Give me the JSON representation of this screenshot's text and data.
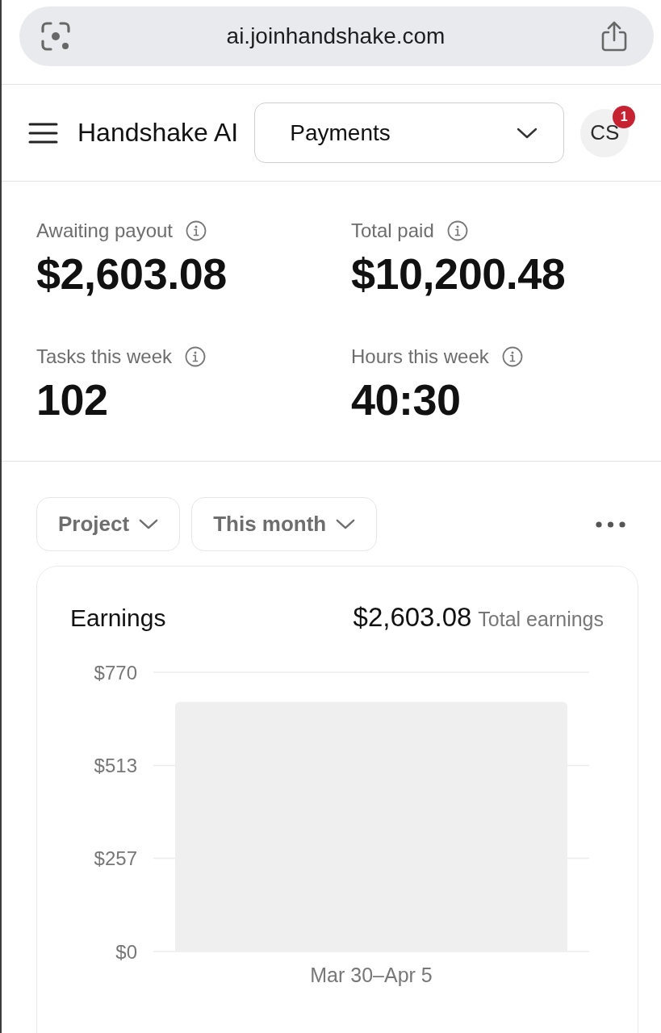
{
  "browser_bar": {
    "url": "ai.joinhandshake.com"
  },
  "header": {
    "app_name": "Handshake AI",
    "page_select": {
      "value": "Payments"
    },
    "avatar": {
      "initials": "CS",
      "badge": "1"
    }
  },
  "stats": [
    {
      "label": "Awaiting payout",
      "value": "$2,603.08"
    },
    {
      "label": "Total paid",
      "value": "$10,200.48"
    },
    {
      "label": "Tasks this week",
      "value": "102"
    },
    {
      "label": "Hours this week",
      "value": "40:30"
    }
  ],
  "filters": [
    {
      "label": "Project"
    },
    {
      "label": "This month"
    }
  ],
  "earnings_card": {
    "title": "Earnings",
    "total": "$2,603.08",
    "total_label": "Total earnings",
    "chart_data": {
      "type": "bar",
      "categories": [
        "Mar 30–Apr 5"
      ],
      "values": [
        688
      ],
      "ylim": [
        0,
        770
      ],
      "yticks": [
        {
          "value": 0,
          "label": "$0"
        },
        {
          "value": 257,
          "label": "$257"
        },
        {
          "value": 513,
          "label": "$513"
        },
        {
          "value": 770,
          "label": "$770"
        }
      ]
    }
  }
}
